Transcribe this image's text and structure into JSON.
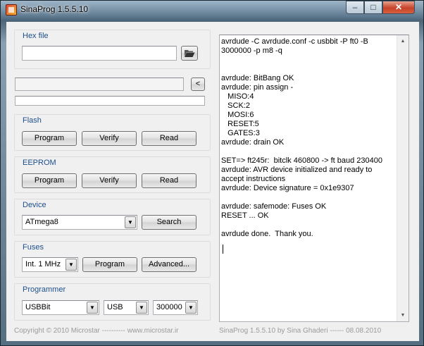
{
  "window": {
    "title": "SinaProg 1.5.5.10",
    "minimize": "–",
    "maximize": "□",
    "close": "✕"
  },
  "hex": {
    "title": "Hex file",
    "path": "",
    "back_label": "<"
  },
  "flash": {
    "title": "Flash",
    "program": "Program",
    "verify": "Verify",
    "read": "Read"
  },
  "eeprom": {
    "title": "EEPROM",
    "program": "Program",
    "verify": "Verify",
    "read": "Read"
  },
  "device": {
    "title": "Device",
    "selected": "ATmega8",
    "search": "Search"
  },
  "fuses": {
    "title": "Fuses",
    "selected": "Int. 1 MHz",
    "program": "Program",
    "advanced": "Advanced..."
  },
  "programmer": {
    "title": "Programmer",
    "selected": "USBBit",
    "port": "USB",
    "baud": "300000"
  },
  "log": {
    "text": "avrdude -C avrdude.conf -c usbbit -P ft0 -B 3000000 -p m8 -q\n\n\navrdude: BitBang OK\navrdude: pin assign -\n   MISO:4\n   SCK:2\n   MOSI:6\n   RESET:5\n   GATES:3\navrdude: drain OK\n\nSET=> ft245r:  bitclk 460800 -> ft baud 230400\navrdude: AVR device initialized and ready to accept instructions\navrdude: Device signature = 0x1e9307\n\navrdude: safemode: Fuses OK\nRESET ... OK\n\navrdude done.  Thank you."
  },
  "footer": {
    "left": "Copyright © 2010 Microstar  ----------   www.microstar.ir",
    "right": "SinaProg 1.5.5.10  by  Sina Ghaderi   ------   08.08.2010"
  },
  "icons": {
    "folder": "folder-open-icon",
    "app": "app-icon",
    "dropdown": "chevron-down-icon"
  }
}
